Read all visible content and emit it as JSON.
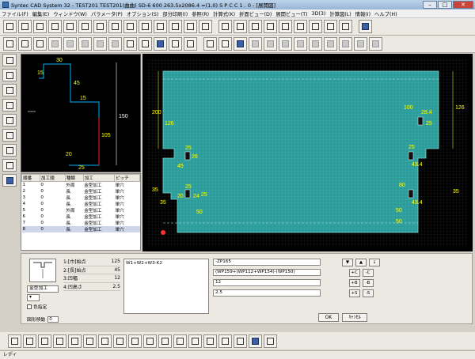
{
  "window": {
    "title": "Syntec CAD System 32  - TEST201 TEST201(曲曲) SD-6 600 263.5x2086.4 =(1,0) S P C C 1 .  0 - [展開図]"
  },
  "menu": [
    "ファイル(F)",
    "編集(E)",
    "ウィンドウ(W)",
    "パラメータ(P)",
    "オプション(S)",
    "部分印刷(I)",
    "参照(R)",
    "計算式(K)",
    "折面ビュー(D)",
    "展開ビュー(T)",
    "3D(3)",
    "計算図(L)",
    "情報(I)",
    "ヘルプ(H)"
  ],
  "preview": {
    "dims": [
      "30",
      "15",
      "45",
      "15",
      "150",
      "105",
      "25",
      "20"
    ]
  },
  "parts_table": {
    "headers": [
      "順番",
      "加工順",
      "種類",
      "加工",
      "ピッチ"
    ],
    "rows": [
      [
        "1",
        "0",
        "外周",
        "金型加工",
        "単穴"
      ],
      [
        "2",
        "0",
        "長.",
        "金型加工",
        "単穴"
      ],
      [
        "3",
        "0",
        "長.",
        "金型加工",
        "単穴"
      ],
      [
        "4",
        "0",
        "長.",
        "金型加工",
        "単穴"
      ],
      [
        "5",
        "0",
        "外周",
        "金型加工",
        "単穴"
      ],
      [
        "6",
        "0",
        "長.",
        "金型加工",
        "単穴"
      ],
      [
        "7",
        "0",
        "長.",
        "金型加工",
        "単穴"
      ],
      [
        "8",
        "0",
        "長.",
        "金型加工",
        "単穴"
      ]
    ]
  },
  "canvas": {
    "dims": [
      "200",
      "126",
      "28.4",
      "25",
      "35",
      "25",
      "26",
      "50",
      "25",
      "20",
      "24",
      "45",
      "25",
      "35",
      "126",
      "100",
      "43.4",
      "50",
      "80",
      "35",
      "43.4",
      "50",
      "25"
    ]
  },
  "params": {
    "items": [
      {
        "label": "1:[巾]始点",
        "value": "125"
      },
      {
        "label": "2:[長]始点",
        "value": "45"
      },
      {
        "label": "3:凹幅",
        "value": "12"
      },
      {
        "label": "4:凹高さ",
        "value": "2.5"
      }
    ],
    "process_combo": "金型加工",
    "color_check": "色指定",
    "rotation_label": "図形移動",
    "rotation_value": "0",
    "formula_text": "W1+W2+W3-K2",
    "fields": [
      "-ZP165",
      "(WP159+(WP112+WP154)-(WP150)",
      "12",
      "2.5"
    ],
    "pad": [
      "▼",
      "▲",
      "↓",
      "+C",
      "-C",
      "+B",
      "-B",
      "+S",
      "-S"
    ],
    "ok": "OK",
    "cancel": "ｷｬﾝｾﾙ"
  },
  "status": {
    "text": "レディ"
  }
}
